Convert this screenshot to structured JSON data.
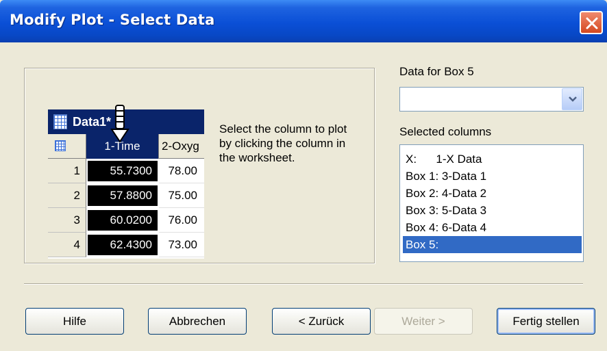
{
  "window": {
    "title": "Modify Plot - Select Data"
  },
  "worksheet": {
    "title": "Data1*",
    "col1_header": "1-Time",
    "col2_header": "2-Oxyg",
    "rows": [
      {
        "num": "1",
        "c1": "55.7300",
        "c2": "78.00"
      },
      {
        "num": "2",
        "c1": "57.8800",
        "c2": "75.00"
      },
      {
        "num": "3",
        "c1": "60.0200",
        "c2": "76.00"
      },
      {
        "num": "4",
        "c1": "62.4300",
        "c2": "73.00"
      }
    ]
  },
  "instructions": "Select the column to plot by clicking the column in the worksheet.",
  "data_for": {
    "label": "Data for Box 5",
    "value": ""
  },
  "selected": {
    "label": "Selected columns",
    "items": [
      "X:      1-X Data",
      "Box 1: 3-Data 1",
      "Box 2: 4-Data 2",
      "Box 3: 5-Data 3",
      "Box 4: 6-Data 4",
      "Box 5:"
    ],
    "selected_index": 5
  },
  "buttons": {
    "help": "Hilfe",
    "cancel": "Abbrechen",
    "back": "< Zurück",
    "next": "Weiter >",
    "finish": "Fertig stellen"
  },
  "icons": {
    "close": "close-icon",
    "dropdown": "chevron-down-icon",
    "cursor": "column-select-cursor-icon"
  },
  "colors": {
    "titlebar": "#0a4fd6",
    "selection": "#316ac5",
    "worksheet_header": "#0a246a"
  }
}
